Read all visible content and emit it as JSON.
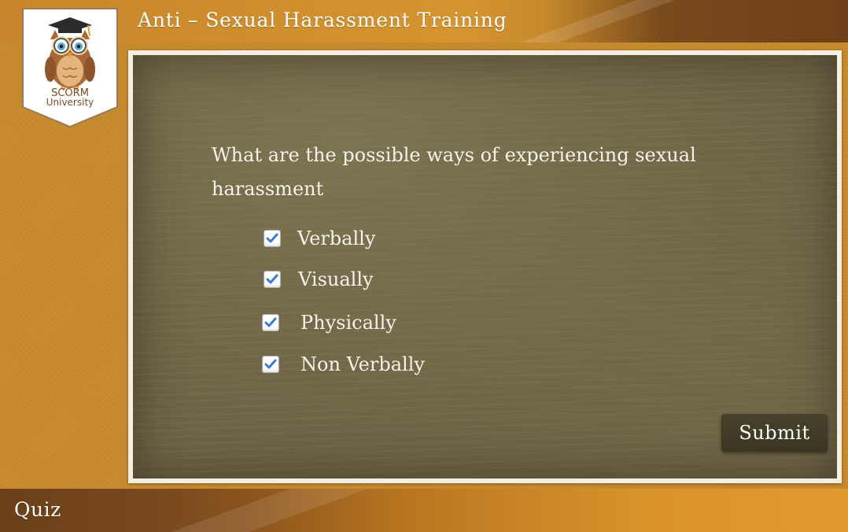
{
  "header": {
    "title": "Anti – Sexual Harassment Training",
    "logo": {
      "line1": "SCORM",
      "line2": "University"
    }
  },
  "quiz": {
    "question": "What are the possible ways of experiencing sexual harassment",
    "options": [
      {
        "label": "Verbally",
        "checked": true
      },
      {
        "label": "Visually",
        "checked": true
      },
      {
        "label": "Physically",
        "checked": true
      },
      {
        "label": "Non Verbally",
        "checked": true
      }
    ],
    "submit_label": "Submit"
  },
  "footer": {
    "section_label": "Quiz"
  },
  "colors": {
    "accent": "#d69430",
    "board": "#6e6446",
    "check": "#3a7bd5",
    "button": "#403a26"
  },
  "icons": {
    "logo": "owl-graduate-icon",
    "check": "checkmark-icon"
  }
}
